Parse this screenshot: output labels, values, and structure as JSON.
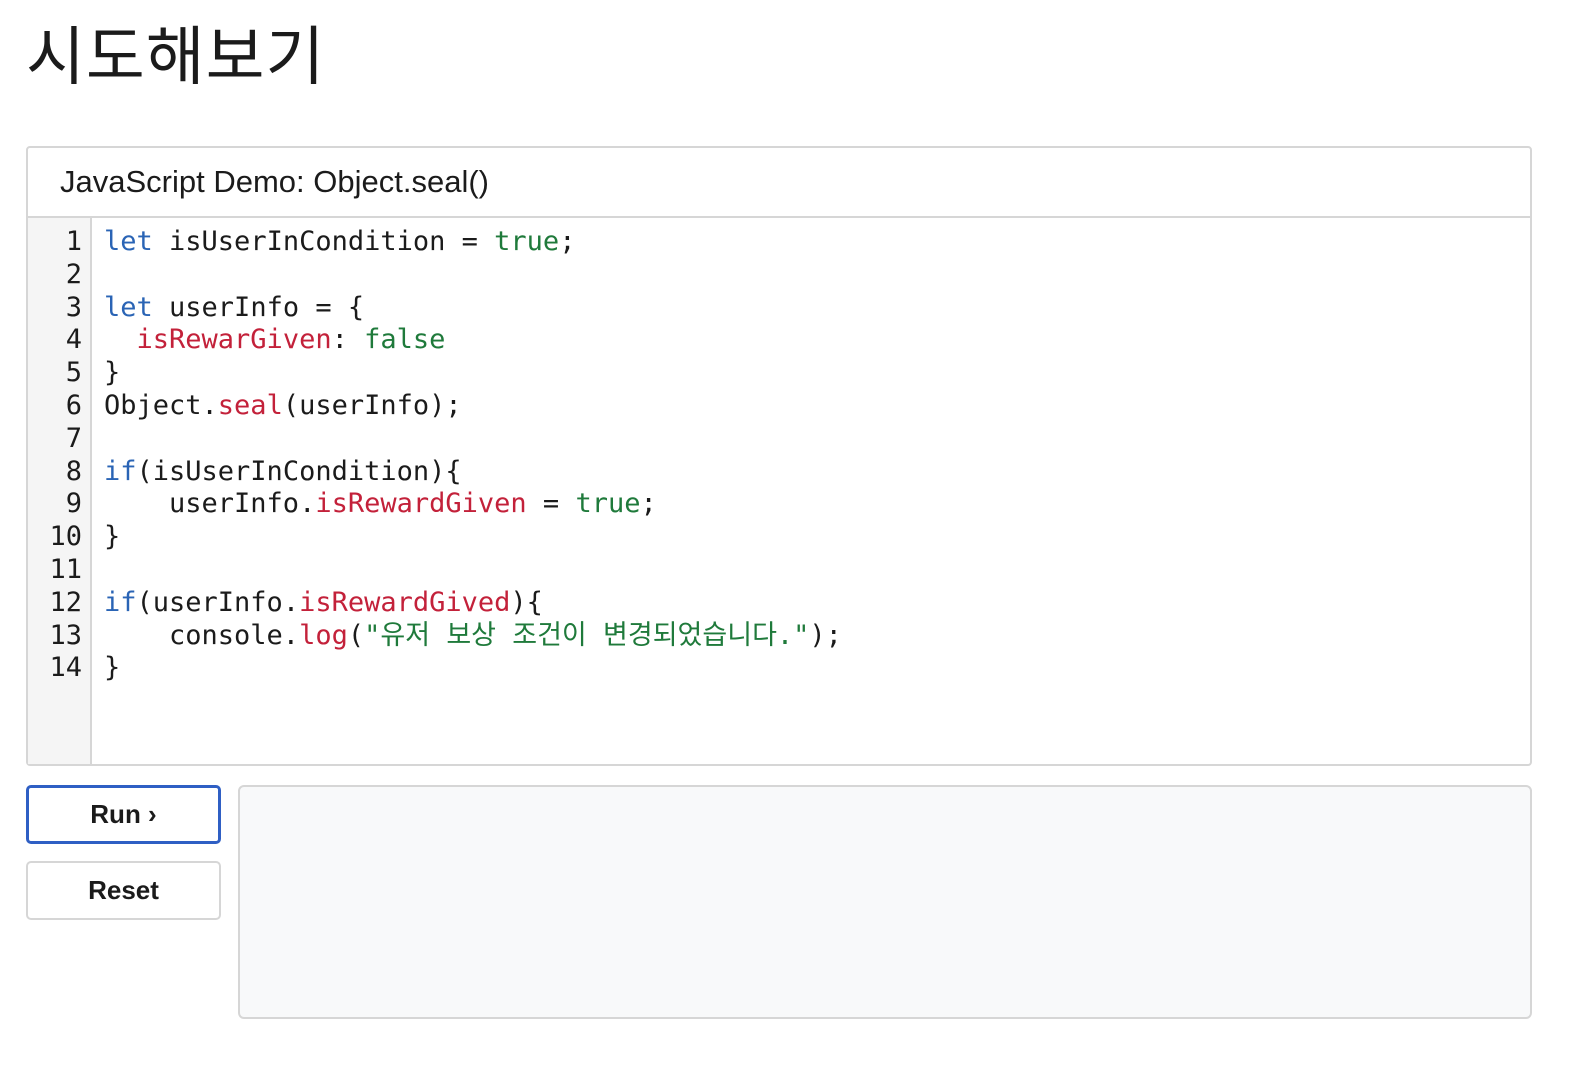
{
  "page": {
    "title": "시도해보기"
  },
  "editor": {
    "header": "JavaScript Demo: Object.seal()",
    "line_numbers": [
      "1",
      "2",
      "3",
      "4",
      "5",
      "6",
      "7",
      "8",
      "9",
      "10",
      "11",
      "12",
      "13",
      "14"
    ],
    "code": [
      [
        {
          "t": "let",
          "c": "kw"
        },
        {
          "t": " isUserInCondition = "
        },
        {
          "t": "true",
          "c": "val"
        },
        {
          "t": ";"
        }
      ],
      [],
      [
        {
          "t": "let",
          "c": "kw"
        },
        {
          "t": " userInfo = {"
        }
      ],
      [
        {
          "t": "  "
        },
        {
          "t": "isRewarGiven",
          "c": "prop"
        },
        {
          "t": ": "
        },
        {
          "t": "false",
          "c": "val"
        }
      ],
      [
        {
          "t": "}"
        }
      ],
      [
        {
          "t": "Object."
        },
        {
          "t": "seal",
          "c": "prop"
        },
        {
          "t": "(userInfo);"
        }
      ],
      [],
      [
        {
          "t": "if",
          "c": "kw"
        },
        {
          "t": "(isUserInCondition){"
        }
      ],
      [
        {
          "t": "    userInfo."
        },
        {
          "t": "isRewardGiven",
          "c": "prop"
        },
        {
          "t": " = "
        },
        {
          "t": "true",
          "c": "val"
        },
        {
          "t": ";"
        }
      ],
      [
        {
          "t": "}"
        }
      ],
      [],
      [
        {
          "t": "if",
          "c": "kw"
        },
        {
          "t": "(userInfo."
        },
        {
          "t": "isRewardGived",
          "c": "prop"
        },
        {
          "t": "){"
        }
      ],
      [
        {
          "t": "    console."
        },
        {
          "t": "log",
          "c": "prop"
        },
        {
          "t": "("
        },
        {
          "t": "\"유저 보상 조건이 변경되었습니다.\"",
          "c": "str"
        },
        {
          "t": ");"
        }
      ],
      [
        {
          "t": "}"
        }
      ]
    ]
  },
  "controls": {
    "run_label": "Run ›",
    "reset_label": "Reset"
  },
  "output": {
    "text": ""
  },
  "colors": {
    "keyword": "#2a64b5",
    "property": "#c3213a",
    "value": "#1f7a3b",
    "run_border": "#2f5fc4"
  }
}
